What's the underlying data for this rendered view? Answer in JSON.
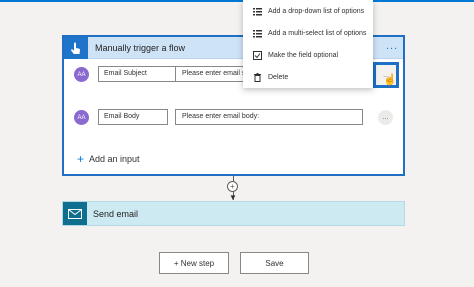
{
  "trigger": {
    "title": "Manually trigger a flow",
    "more_label": "...",
    "inputs": [
      {
        "avatar_text": "AA",
        "label": "Email Subject",
        "placeholder": "Please enter email su",
        "more_label": "..."
      },
      {
        "avatar_text": "AA",
        "label": "Email Body",
        "placeholder": "Please enter email body:",
        "more_label": "..."
      }
    ],
    "add_input_label": "Add an input"
  },
  "action": {
    "title": "Send email"
  },
  "buttons": {
    "new_step": "+ New step",
    "save": "Save"
  },
  "menu": {
    "items": [
      {
        "label": "Add a drop-down list of options",
        "icon": "list-icon"
      },
      {
        "label": "Add a multi-select list of options",
        "icon": "multi-list-icon"
      },
      {
        "label": "Make the field optional",
        "icon": "checkbox-icon"
      },
      {
        "label": "Delete",
        "icon": "trash-icon"
      }
    ]
  },
  "colors": {
    "accent": "#1f6fc5",
    "trigger_header": "#cfe3f7",
    "action_header": "#cde9f1",
    "avatar": "#8a6ad0"
  }
}
